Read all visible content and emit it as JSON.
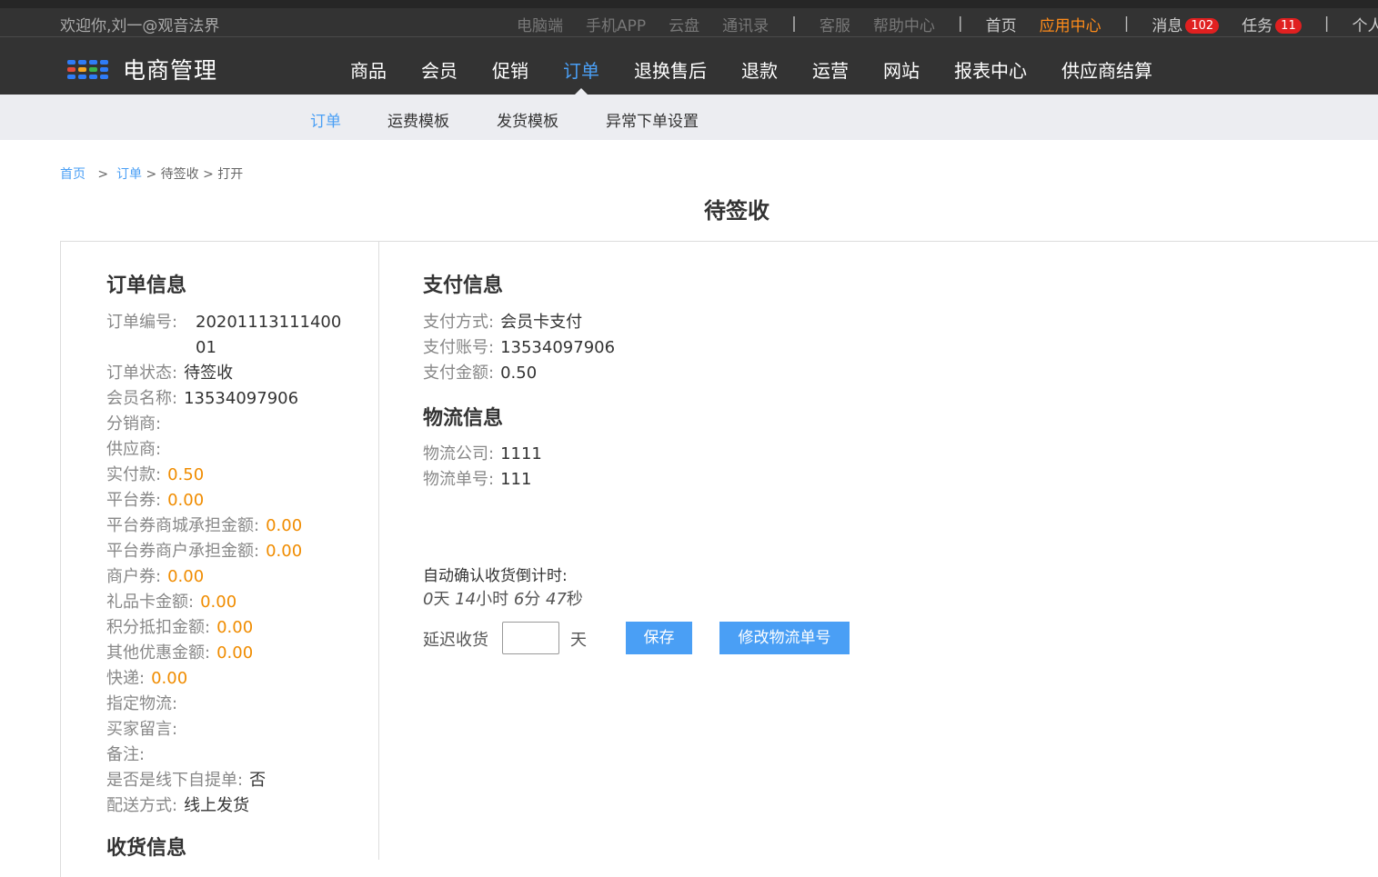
{
  "topbar": {
    "welcome": "欢迎你,刘一@观音法界",
    "links": [
      "电脑端",
      "手机APP",
      "云盘",
      "通讯录"
    ],
    "support_links": [
      "客服",
      "帮助中心"
    ],
    "home": "首页",
    "app_center": "应用中心",
    "messages_label": "消息",
    "messages_count": "102",
    "tasks_label": "任务",
    "tasks_count": "11",
    "personal": "个人",
    "separator": "|"
  },
  "logo": {
    "text": "电商管理",
    "colors": [
      "#2f7cf6",
      "#2f7cf6",
      "#2f7cf6",
      "#2f7cf6",
      "#e24a3b",
      "#f5a623",
      "#3bb34a",
      "#2f7cf6",
      "#2f7cf6",
      "#2f7cf6",
      "#2f7cf6",
      "#2f7cf6"
    ]
  },
  "main_nav": [
    "商品",
    "会员",
    "促销",
    "订单",
    "退换售后",
    "退款",
    "运营",
    "网站",
    "报表中心",
    "供应商结算"
  ],
  "main_nav_active": "订单",
  "sub_nav": [
    "订单",
    "运费模板",
    "发货模板",
    "异常下单设置"
  ],
  "breadcrumb": {
    "home": "首页",
    "sep": ">",
    "order": "订单",
    "pending": "待签收",
    "open": "打开"
  },
  "page_title": "待签收",
  "order_info": {
    "title": "订单信息",
    "order_no_label": "订单编号:",
    "order_no_line1": "20201113111400",
    "order_no_line2": "01",
    "rows": [
      {
        "k": "订单状态:",
        "v": "待签收",
        "orange": false
      },
      {
        "k": "会员名称:",
        "v": "13534097906",
        "orange": false
      },
      {
        "k": "分销商:",
        "v": "",
        "orange": false
      },
      {
        "k": "供应商:",
        "v": "",
        "orange": false
      },
      {
        "k": "实付款:",
        "v": "0.50",
        "orange": true
      },
      {
        "k": "平台券:",
        "v": "0.00",
        "orange": true
      },
      {
        "k": "平台券商城承担金额:",
        "v": "0.00",
        "orange": true
      },
      {
        "k": "平台券商户承担金额:",
        "v": "0.00",
        "orange": true
      },
      {
        "k": "商户券:",
        "v": "0.00",
        "orange": true
      },
      {
        "k": "礼品卡金额:",
        "v": "0.00",
        "orange": true
      },
      {
        "k": "积分抵扣金额:",
        "v": "0.00",
        "orange": true
      },
      {
        "k": "其他优惠金额:",
        "v": "0.00",
        "orange": true
      },
      {
        "k": "快递:",
        "v": "0.00",
        "orange": true
      },
      {
        "k": "指定物流:",
        "v": "",
        "orange": false
      },
      {
        "k": "买家留言:",
        "v": "",
        "orange": false
      },
      {
        "k": "备注:",
        "v": "",
        "orange": false
      },
      {
        "k": "是否是线下自提单:",
        "v": "否",
        "orange": false
      },
      {
        "k": "配送方式:",
        "v": "线上发货",
        "orange": false
      }
    ],
    "next_title": "收货信息"
  },
  "payment_info": {
    "title": "支付信息",
    "rows": [
      {
        "k": "支付方式:",
        "v": "会员卡支付"
      },
      {
        "k": "支付账号:",
        "v": "13534097906"
      },
      {
        "k": "支付金额:",
        "v": "0.50"
      }
    ]
  },
  "logistics_info": {
    "title": "物流信息",
    "rows": [
      {
        "k": "物流公司:",
        "v": "1111"
      },
      {
        "k": "物流单号:",
        "v": "111"
      }
    ]
  },
  "countdown": {
    "label": "自动确认收货倒计时:",
    "days": "0",
    "days_unit": "天",
    "hours": "14",
    "hours_unit": "小时",
    "minutes": "6",
    "minutes_unit": "分",
    "seconds": "47",
    "seconds_unit": "秒"
  },
  "delay": {
    "label": "延迟收货",
    "input_value": "",
    "unit": "天",
    "save_button": "保存",
    "modify_button": "修改物流单号"
  }
}
